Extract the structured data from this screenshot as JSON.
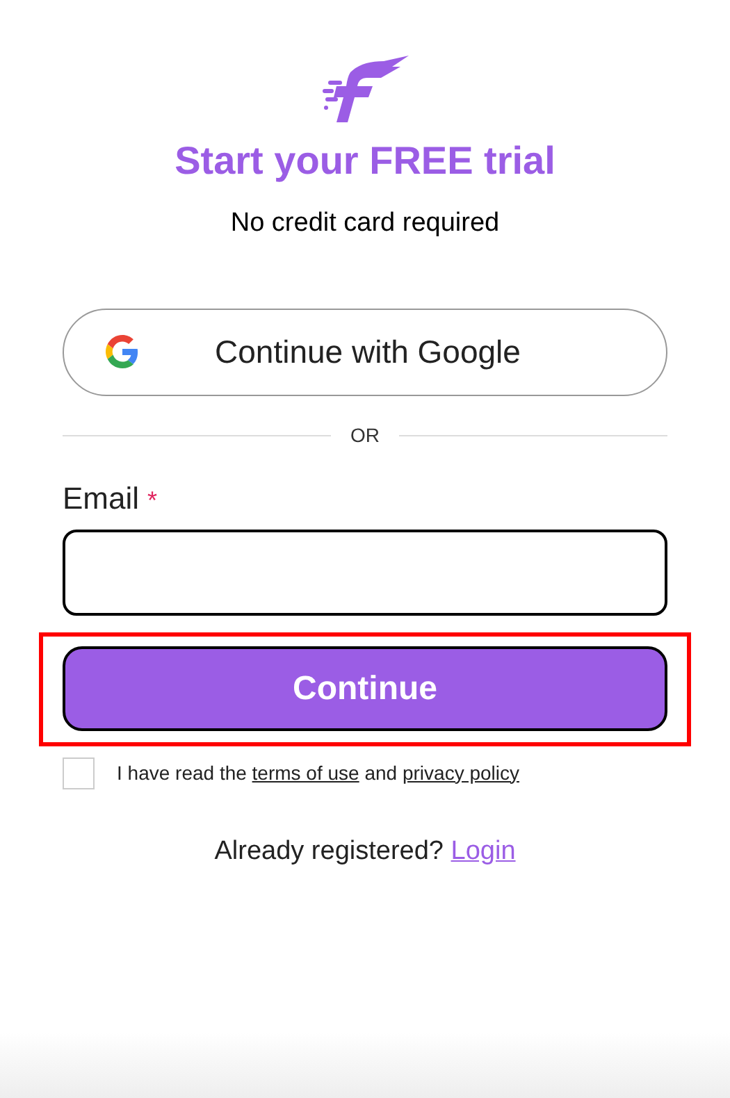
{
  "title": "Start your FREE trial",
  "subtitle": "No credit card required",
  "google_button": {
    "label": "Continue with Google"
  },
  "divider": {
    "label": "OR"
  },
  "email": {
    "label": "Email",
    "required_mark": "*"
  },
  "continue_button": {
    "label": "Continue",
    "highlighted": true
  },
  "agreement": {
    "checked": false,
    "before": "I have read the",
    "terms_link": "terms of use",
    "middle": "and",
    "privacy_link": "privacy policy"
  },
  "login_prompt": {
    "text": "Already registered?",
    "link": "Login"
  }
}
